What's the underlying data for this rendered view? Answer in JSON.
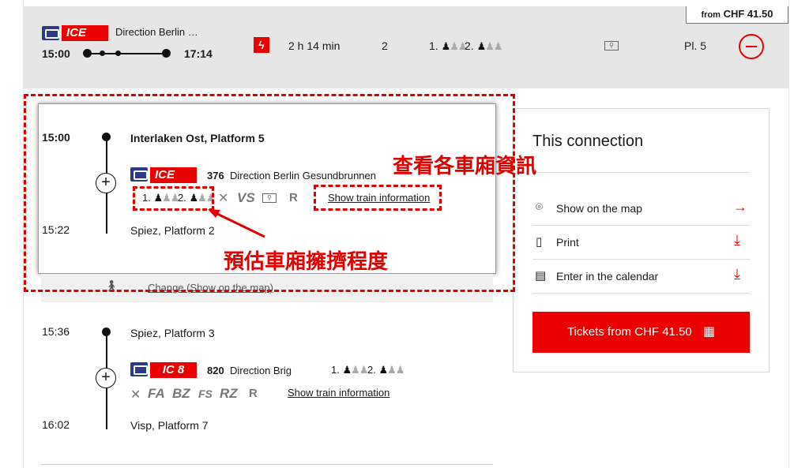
{
  "summary": {
    "price_flag_prefix": "from",
    "price_flag_value": "CHF 41.50",
    "train_badge": "ICE",
    "direction": "Direction Berlin …",
    "depart_time": "15:00",
    "arrive_time": "17:14",
    "duration": "2 h 14 min",
    "changes": "2",
    "occupancy_first": "1.",
    "occupancy_second": "2.",
    "platform": "Pl. 5"
  },
  "leg1": {
    "depart_time": "15:00",
    "depart_station": "Interlaken Ost, Platform 5",
    "badge": "ICE",
    "train_number": "376",
    "direction": "Direction Berlin Gesundbrunnen",
    "occ_first": "1.",
    "occ_second": "2.",
    "features": [
      "VS",
      "R"
    ],
    "info_link": "Show train information",
    "arrive_time": "15:22",
    "arrive_station": "Spiez, Platform 2"
  },
  "change": {
    "label": "Change (Show on the map)"
  },
  "leg2": {
    "depart_time": "15:36",
    "depart_station": "Spiez, Platform 3",
    "badge": "IC 8",
    "train_number": "820",
    "direction": "Direction Brig",
    "occ_first": "1.",
    "occ_second": "2.",
    "features": [
      "FA",
      "BZ",
      "FS",
      "RZ",
      "R"
    ],
    "info_link": "Show train information",
    "arrive_time": "16:02",
    "arrive_station": "Visp, Platform 7"
  },
  "panel": {
    "title": "This connection",
    "items": [
      {
        "label": "Show on the map",
        "icon": "map-pin-icon"
      },
      {
        "label": "Print",
        "icon": "pdf-icon"
      },
      {
        "label": "Enter in the calendar",
        "icon": "calendar-icon"
      }
    ],
    "ticket_button": "Tickets from CHF 41.50"
  },
  "annotations": {
    "car_info": "查看各車廂資訊",
    "occupancy": "預估車廂擁擠程度"
  },
  "colors": {
    "accent": "#eb0000",
    "train_icon": "#2b3a8a",
    "band": "#e6e6e6"
  }
}
